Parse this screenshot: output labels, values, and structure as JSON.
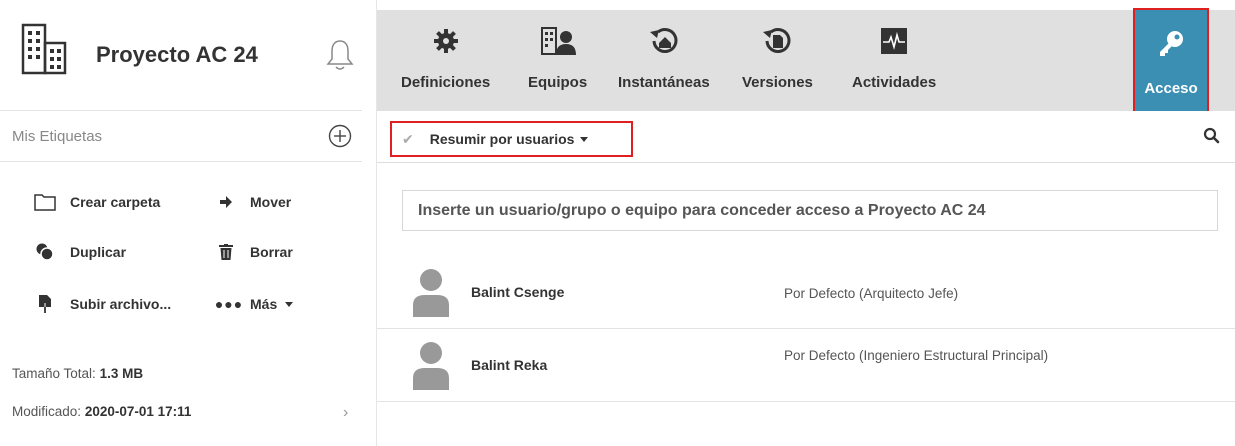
{
  "project": {
    "title": "Proyecto AC 24",
    "icon": "building-icon",
    "notification_icon": "bell-icon"
  },
  "tags": {
    "label": "Mis Etiquetas",
    "add_icon": "plus-circle-icon"
  },
  "actions": {
    "create_folder": "Crear carpeta",
    "move": "Mover",
    "duplicate": "Duplicar",
    "delete": "Borrar",
    "upload": "Subir archivo...",
    "more": "Más"
  },
  "info": {
    "size_label": "Tamaño Total:",
    "size_value": "1.3 MB",
    "modified_label": "Modificado:",
    "modified_value": "2020-07-01 17:11"
  },
  "toolbar": {
    "items": [
      {
        "label": "Definiciones",
        "icon": "gear-icon"
      },
      {
        "label": "Equipos",
        "icon": "teams-icon"
      },
      {
        "label": "Instantáneas",
        "icon": "snapshot-icon"
      },
      {
        "label": "Versiones",
        "icon": "versions-icon"
      },
      {
        "label": "Actividades",
        "icon": "activity-icon"
      }
    ],
    "access": {
      "label": "Acceso",
      "icon": "key-icon",
      "active": true
    }
  },
  "filter": {
    "label": "Resumir por usuarios"
  },
  "access_input": {
    "placeholder": "Inserte un usuario/grupo o equipo para conceder acceso a Proyecto AC 24"
  },
  "users": [
    {
      "name": "Balint Csenge",
      "role": "Por Defecto  (Arquitecto Jefe)"
    },
    {
      "name": "Balint Reka",
      "role": "Por Defecto  (Ingeniero Estructural Principal)"
    }
  ],
  "colors": {
    "accent": "#3b8fb3",
    "highlight_border": "#e02020",
    "toolbar_bg": "#e0e0e0"
  }
}
